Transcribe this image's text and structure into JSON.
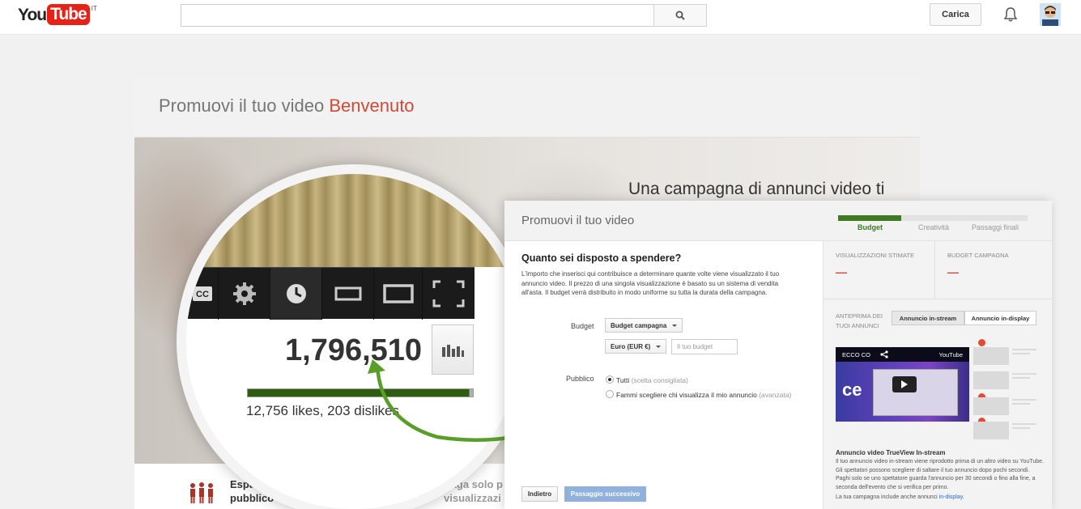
{
  "header": {
    "logo_you": "You",
    "logo_tube": "Tube",
    "logo_country": "IT",
    "search_placeholder": "",
    "upload_label": "Carica"
  },
  "page": {
    "title_main": "Promuovi il tuo video",
    "title_accent": "Benvenuto",
    "hero_text": "Una campagna di annunci video ti",
    "views": "1,796,510",
    "likes": "12,756 likes, 203 dislikes",
    "like_ratio": 0.984,
    "features": [
      {
        "label": "Espandi il tuo pubblico"
      },
      {
        "label": "Paga solo p visualizzazi"
      }
    ]
  },
  "panel": {
    "title": "Promuovi il tuo video",
    "steps": [
      "Budget",
      "Creatività",
      "Passaggi finali"
    ],
    "current_step": 1,
    "form_title": "Quanto sei disposto a spendere?",
    "form_desc": "L'importo che inserisci qui contribuisce a determinare quante volte viene visualizzato il tuo annuncio video. Il prezzo di una singola visualizzazione è basato su un sistema di vendita all'asta. Il budget verrà distribuito in modo uniforme su tutta la durata della campagna.",
    "budget_label": "Budget",
    "budget_type": "Budget campagna",
    "currency": "Euro (EUR €)",
    "budget_placeholder": "Il tuo budget",
    "audience_label": "Pubblico",
    "audience_all": "Tutti",
    "audience_all_hint": "(scelta consigliata)",
    "audience_custom": "Fammi scegliere chi visualizza il mio annuncio",
    "audience_custom_hint": "(avanzata)",
    "back_label": "Indietro",
    "next_label": "Passaggio successivo"
  },
  "side": {
    "est_views_label": "VISUALIZZAZIONI STIMATE",
    "est_views_value": "—",
    "budget_label": "BUDGET CAMPAGNA",
    "budget_value": "—",
    "preview_label": "ANTEPRIMA DEI TUOI ANNUNCI",
    "tab_instream": "Annuncio in-stream",
    "tab_indisplay": "Annuncio in-display",
    "video_title": "ECCO CO",
    "video_brand": "YouTube",
    "video_letters": "ce",
    "desc_title": "Annuncio video TrueView In-stream",
    "desc_text": "Il tuo annuncio video in-stream viene riprodotto prima di un altro video su YouTube. Gli spettatori possono scegliere di saltare il tuo annuncio dopo pochi secondi. Paghi solo se uno spettatore guarda l'annuncio per 30 secondi o fino alla fine, a seconda dell'evento che si verifica per primo.",
    "campaign_note": "La tua campagna include anche annunci",
    "campaign_link": "in-display",
    "campaign_dot": "."
  },
  "colors": {
    "brand_red": "#e62117",
    "accent_red": "#d14836",
    "step_green": "#3d7a22",
    "arrow_green": "#5a9e2a",
    "next_blue": "#8fb1dc"
  },
  "icons": [
    "search-icon",
    "bell-icon",
    "settings-icon",
    "clock-icon",
    "chart-icon",
    "people-icon",
    "coins-icon",
    "share-icon",
    "play-icon",
    "arrow-icon"
  ]
}
